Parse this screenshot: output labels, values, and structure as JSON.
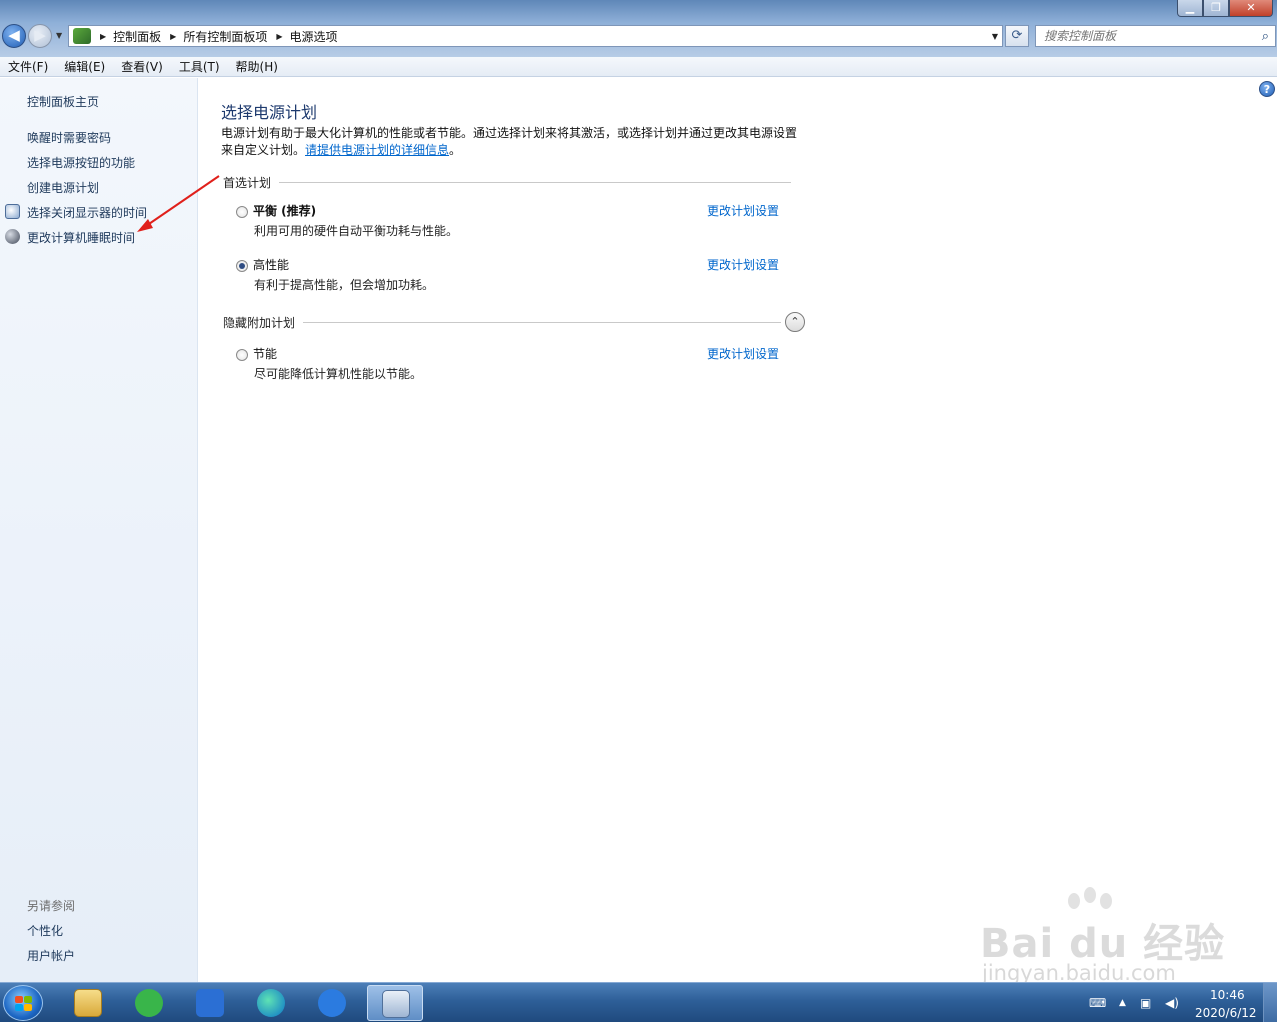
{
  "window": {
    "caption": {
      "minimize": "▁",
      "maximize": "❐",
      "close": "✕"
    }
  },
  "nav": {
    "back_glyph": "◀",
    "forward_glyph": "▶",
    "recent_glyph": "▼"
  },
  "address": {
    "crumbs": [
      "控制面板",
      "所有控制面板项",
      "电源选项"
    ],
    "separator": "▶",
    "dropdown_glyph": "▼",
    "refresh_glyph": "⟳"
  },
  "search": {
    "placeholder": "搜索控制面板",
    "icon": "search-icon"
  },
  "menubar": [
    "文件(F)",
    "编辑(E)",
    "查看(V)",
    "工具(T)",
    "帮助(H)"
  ],
  "sidebar": {
    "home": "控制面板主页",
    "tasks": [
      {
        "label": "唤醒时需要密码",
        "icon": ""
      },
      {
        "label": "选择电源按钮的功能",
        "icon": ""
      },
      {
        "label": "创建电源计划",
        "icon": ""
      },
      {
        "label": "选择关闭显示器的时间",
        "icon": "monitor-clock-icon"
      },
      {
        "label": "更改计算机睡眠时间",
        "icon": "moon-icon"
      }
    ],
    "see_also_title": "另请参阅",
    "see_also": [
      "个性化",
      "用户帐户"
    ]
  },
  "main": {
    "help_glyph": "?",
    "title": "选择电源计划",
    "intro_line1": "电源计划有助于最大化计算机的性能或者节能。通过选择计划来将其激活，或选择计划并通过更改其电源设置",
    "intro_line2_prefix": "来自定义计划。",
    "intro_link": "请提供电源计划的详细信息",
    "intro_line2_suffix": "。",
    "preferred_group": "首选计划",
    "hidden_group": "隐藏附加计划",
    "collapse_glyph": "⌃",
    "plans": [
      {
        "name": "平衡 (推荐)",
        "desc": "利用可用的硬件自动平衡功耗与性能。",
        "link": "更改计划设置",
        "selected": false,
        "bold": true
      },
      {
        "name": "高性能",
        "desc": "有利于提高性能，但会增加功耗。",
        "link": "更改计划设置",
        "selected": true,
        "bold": false
      },
      {
        "name": "节能",
        "desc": "尽可能降低计算机性能以节能。",
        "link": "更改计划设置",
        "selected": false,
        "bold": false
      }
    ]
  },
  "annotation": {
    "arrow_color": "#e0201b"
  },
  "watermark": {
    "main": "Bai du 经验",
    "sub": "jingyan.baidu.com"
  },
  "taskbar": {
    "apps": [
      "file-explorer-icon",
      "wechat-icon",
      "wps-icon",
      "edge-icon",
      "feishu-icon",
      "control-panel-icon"
    ],
    "time": "10:46",
    "date": "2020/6/12"
  }
}
